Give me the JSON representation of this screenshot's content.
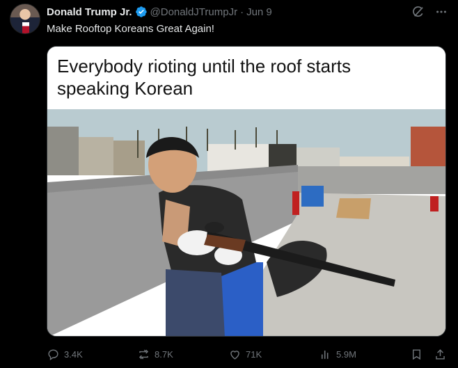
{
  "author": {
    "name": "Donald Trump Jr.",
    "handle": "@DonaldJTrumpJr",
    "separator": "·",
    "date": "Jun 9"
  },
  "tweet": {
    "text": "Make Rooftop Koreans Great Again!"
  },
  "media": {
    "caption": "Everybody rioting until the roof starts\nspeaking Korean"
  },
  "actions": {
    "replies": "3.4K",
    "retweets": "8.7K",
    "likes": "71K",
    "views": "5.9M"
  },
  "icons": {
    "verified": "verified-badge-icon",
    "grok": "grok-icon",
    "more": "more-icon",
    "reply": "reply-icon",
    "retweet": "retweet-icon",
    "like": "heart-icon",
    "views": "views-chart-icon",
    "bookmark": "bookmark-icon",
    "share": "share-icon"
  },
  "colors": {
    "background": "#000000",
    "text": "#e7e9ea",
    "muted": "#71767b",
    "verified": "#1d9bf0"
  }
}
